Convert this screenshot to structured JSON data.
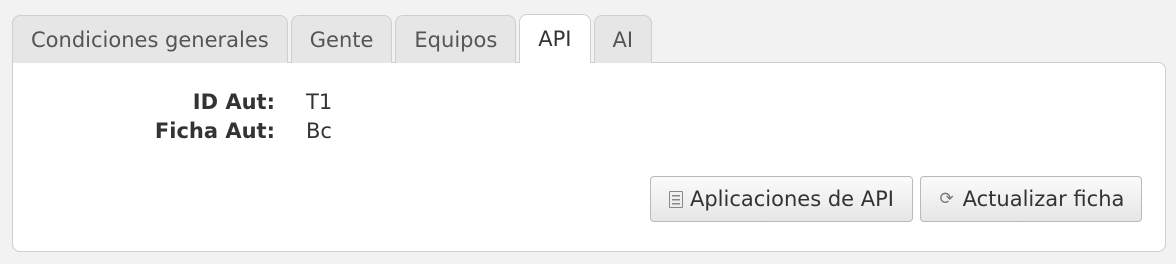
{
  "tabs": [
    {
      "label": "Condiciones generales",
      "active": false
    },
    {
      "label": "Gente",
      "active": false
    },
    {
      "label": "Equipos",
      "active": false
    },
    {
      "label": "API",
      "active": true
    },
    {
      "label": "AI",
      "active": false
    }
  ],
  "api": {
    "fields": [
      {
        "label": "ID Aut:",
        "value": "T1"
      },
      {
        "label": "Ficha Aut:",
        "value": "Bc"
      }
    ],
    "buttons": {
      "api_apps_label": "Aplicaciones de API",
      "api_apps_icon": "list-icon",
      "refresh_label": "Actualizar ficha",
      "refresh_icon": "refresh-icon"
    }
  }
}
